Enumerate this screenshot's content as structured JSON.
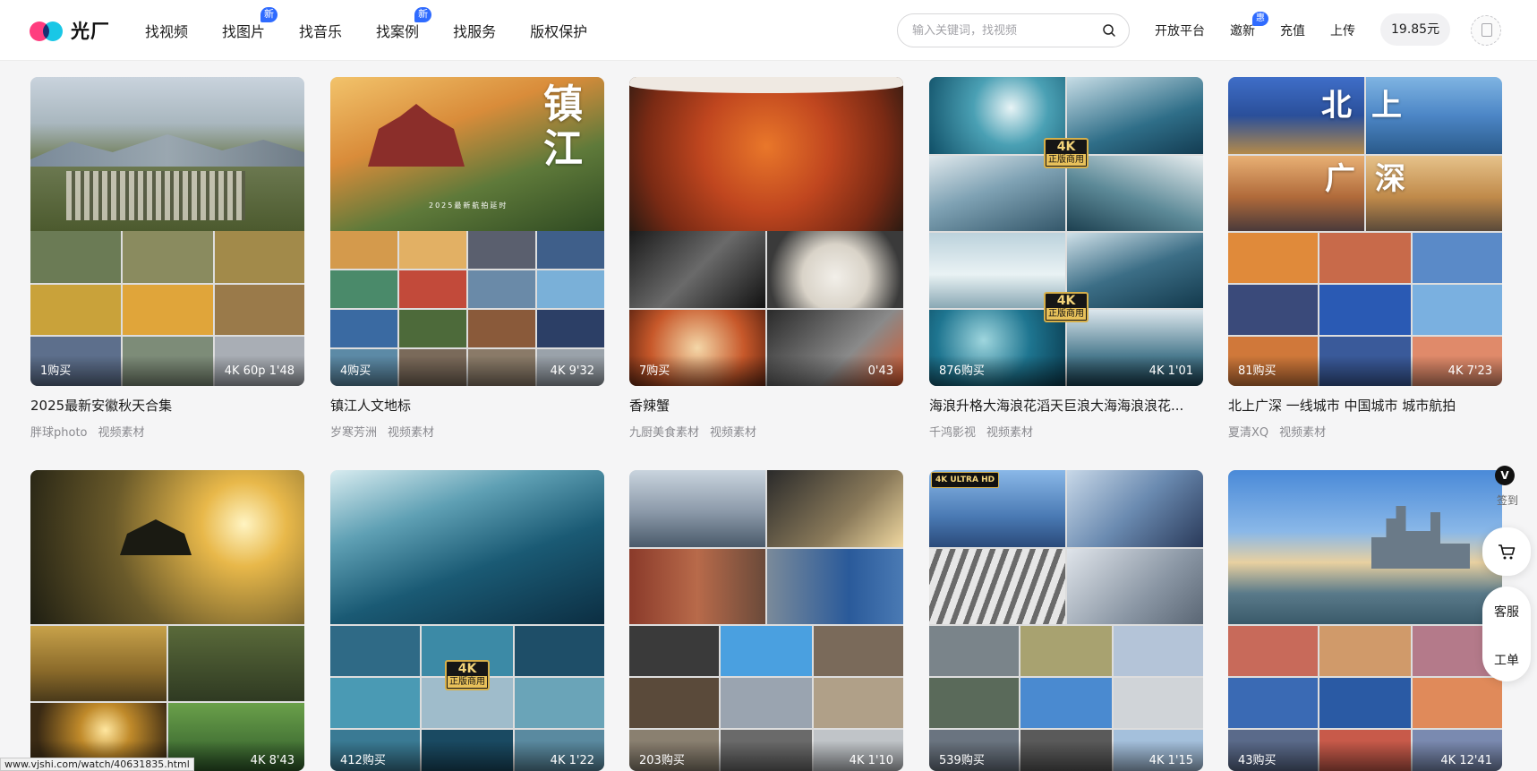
{
  "header": {
    "logo_text": "光厂",
    "nav": [
      {
        "label": "找视频",
        "badge": ""
      },
      {
        "label": "找图片",
        "badge": "新"
      },
      {
        "label": "找音乐",
        "badge": ""
      },
      {
        "label": "找案例",
        "badge": "新"
      },
      {
        "label": "找服务",
        "badge": ""
      },
      {
        "label": "版权保护",
        "badge": ""
      }
    ],
    "search_placeholder": "输入关键词，找视频",
    "links": {
      "open_platform": "开放平台",
      "invite": "邀新",
      "invite_badge": "惠",
      "recharge": "充值",
      "upload": "上传"
    },
    "balance": "19.85元"
  },
  "cards": [
    {
      "title": "2025最新安徽秋天合集",
      "author": "胖球photo",
      "category": "视频素材",
      "purchases": "1购买",
      "duration": "4K  60p  1'48"
    },
    {
      "title": "镇江人文地标",
      "author": "岁寒芳洲",
      "category": "视频素材",
      "purchases": "4购买",
      "duration": "4K  9'32",
      "calligraphy": "镇江",
      "caption": "2025最新航拍延时"
    },
    {
      "title": "香辣蟹",
      "author": "九厨美食素材",
      "category": "视频素材",
      "purchases": "7购买",
      "duration": "0'43"
    },
    {
      "title": "海浪升格大海浪花滔天巨浪大海海浪浪花...",
      "author": "千鸿影视",
      "category": "视频素材",
      "purchases": "876购买",
      "duration": "4K  1'01",
      "tag_big": "4K",
      "tag_small": "正版商用"
    },
    {
      "title": "北上广深 一线城市 中国城市 城市航拍",
      "author": "夏清XQ",
      "category": "视频素材",
      "purchases": "81购买",
      "duration": "4K  7'23",
      "calligraphy_a": "北上",
      "calligraphy_b": "广深"
    },
    {
      "title": "",
      "author": "",
      "category": "",
      "purchases": "",
      "duration": "4K  8'43"
    },
    {
      "title": "",
      "author": "",
      "category": "",
      "purchases": "412购买",
      "duration": "4K  1'22",
      "tag_big": "4K",
      "tag_small": "正版商用"
    },
    {
      "title": "",
      "author": "",
      "category": "",
      "purchases": "203购买",
      "duration": "4K  1'10"
    },
    {
      "title": "",
      "author": "",
      "category": "",
      "purchases": "539购买",
      "duration": "4K  1'15",
      "ultra_tag": "4K ULTRA HD"
    },
    {
      "title": "",
      "author": "",
      "category": "",
      "purchases": "43购买",
      "duration": "4K  12'41"
    }
  ],
  "side": {
    "v_badge": "V",
    "v_label": "签到",
    "cs_label": "客服",
    "ticket_label": "工单"
  },
  "status_url": "www.vjshi.com/watch/40631835.html",
  "colors": {
    "accent": "#2f6bff",
    "logo_pink": "#ff3d7f",
    "logo_cyan": "#19c7e6",
    "tag_gold": "#e8c15a"
  }
}
